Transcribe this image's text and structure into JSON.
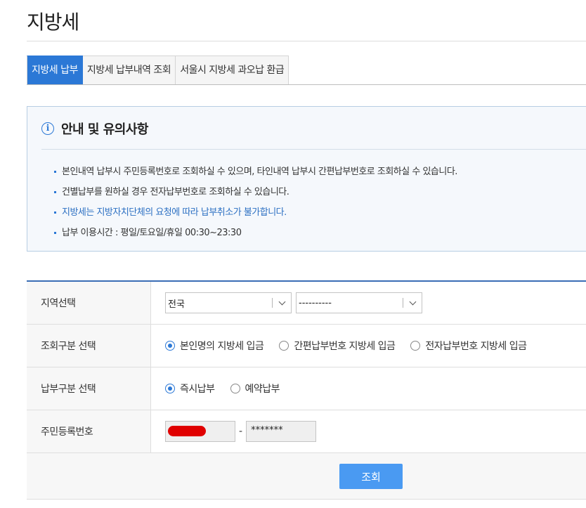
{
  "page": {
    "title": "지방세"
  },
  "tabs": [
    {
      "label": "지방세 납부",
      "active": true
    },
    {
      "label": "지방세 납부내역 조회",
      "active": false
    },
    {
      "label": "서울시 지방세 과오납 환급",
      "active": false
    }
  ],
  "notice": {
    "icon": "info-icon",
    "title": "안내 및 유의사항",
    "items": [
      "본인내역 납부시 주민등록번호로 조회하실 수 있으며, 타인내역 납부시 간편납부번호로 조회하실 수 있습니다.",
      "건별납부를 원하실 경우 전자납부번호로 조회하실 수 있습니다.",
      "지방세는 지방자치단체의 요청에 따라 납부취소가 불가합니다.",
      "납부 이용시간 : 평일/토요일/휴일 00:30~23:30"
    ]
  },
  "form": {
    "region": {
      "label": "지역선택",
      "select1_value": "전국",
      "select2_value": "----------"
    },
    "inquiry_type": {
      "label": "조회구분 선택",
      "options": [
        "본인명의 지방세 입금",
        "간편납부번호 지방세 입금",
        "전자납부번호 지방세 입금"
      ],
      "selected": 0
    },
    "payment_type": {
      "label": "납부구분 선택",
      "options": [
        "즉시납부",
        "예약납부"
      ],
      "selected": 0
    },
    "ssn": {
      "label": "주민등록번호",
      "separator": "-",
      "back_value": "*******"
    }
  },
  "actions": {
    "search_label": "조회"
  },
  "colors": {
    "accent": "#2b78d6",
    "button": "#4a9af2",
    "highlight_text": "#2b6fc2",
    "redaction": "#e00000"
  }
}
